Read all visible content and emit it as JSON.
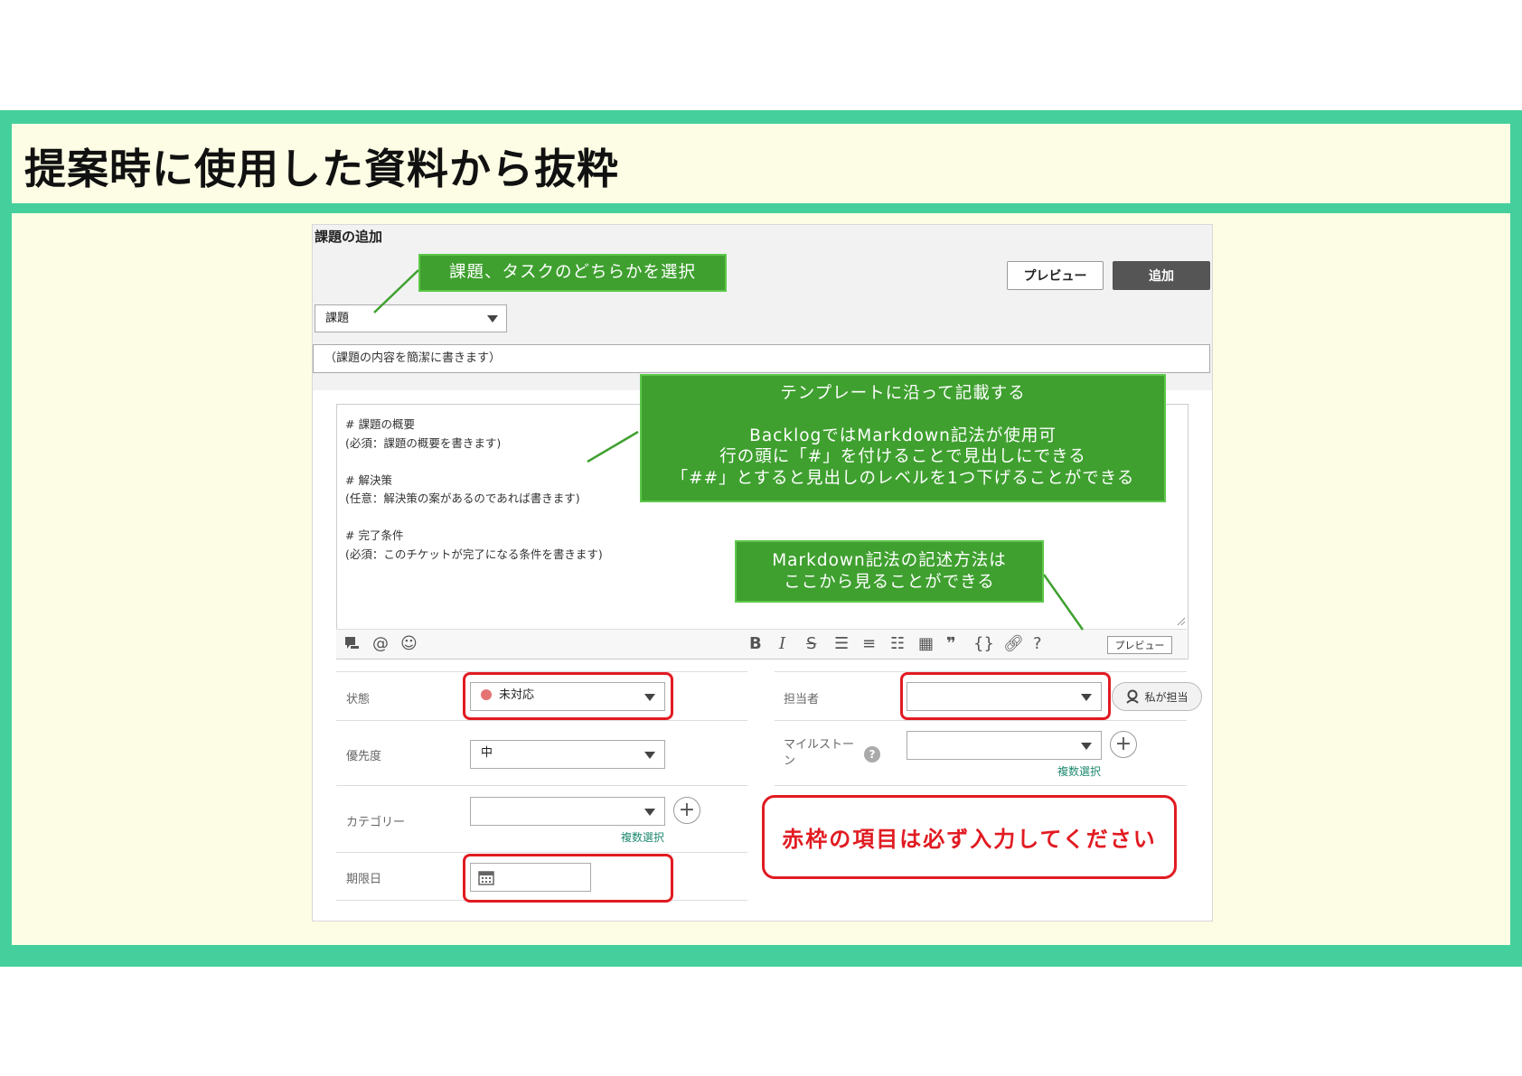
{
  "slide": {
    "title": "提案時に使用した資料から抜粋"
  },
  "screen": {
    "page_title": "課題の追加",
    "preview_button": "プレビュー",
    "add_button": "追加",
    "type_select": {
      "value": "課題"
    },
    "summary_placeholder": "（課題の内容を簡潔に書きます）",
    "editor_text": "# 課題の概要\n(必須：課題の概要を書きます)\n\n# 解決策\n(任意：解決策の案があるのであれば書きます)\n\n# 完了条件\n(必須：このチケットが完了になる条件を書きます)",
    "toolbar_icons": [
      "notification-icon",
      "mention-icon",
      "emoji-icon",
      "bold-icon",
      "italic-icon",
      "strikethrough-icon",
      "bullet-list-icon",
      "numbered-list-icon",
      "checklist-icon",
      "table-icon",
      "quote-icon",
      "code-icon",
      "link-icon",
      "help-icon"
    ],
    "toolbar_preview": "プレビュー",
    "fields": {
      "status_label": "状態",
      "status_value": "未対応",
      "status_color": "#e57373",
      "priority_label": "優先度",
      "priority_value": "中",
      "category_label": "カテゴリー",
      "category_multi": "複数選択",
      "due_label": "期限日",
      "assignee_label": "担当者",
      "assign_me": "私が担当",
      "milestone_label_1": "マイルストー",
      "milestone_label_2": "ン",
      "milestone_multi": "複数選択"
    }
  },
  "callouts": {
    "type_select": "課題、タスクのどちらかを選択",
    "template_title": "テンプレートに沿って記載する",
    "template_line1": "BacklogではMarkdown記法が使用可",
    "template_line2": "行の頭に「#」を付けることで見出しにできる",
    "template_line3": "「##」とすると見出しのレベルを1つ下げることができる",
    "markdown_line1": "Markdown記法の記述方法は",
    "markdown_line2": "ここから見ることができる",
    "required_notice": "赤枠の項目は必ず入力してください"
  },
  "colors": {
    "frame": "#45cf9c",
    "panel": "#fcfde4",
    "callout_green": "#3fa02f",
    "required_red": "#e11b22"
  }
}
